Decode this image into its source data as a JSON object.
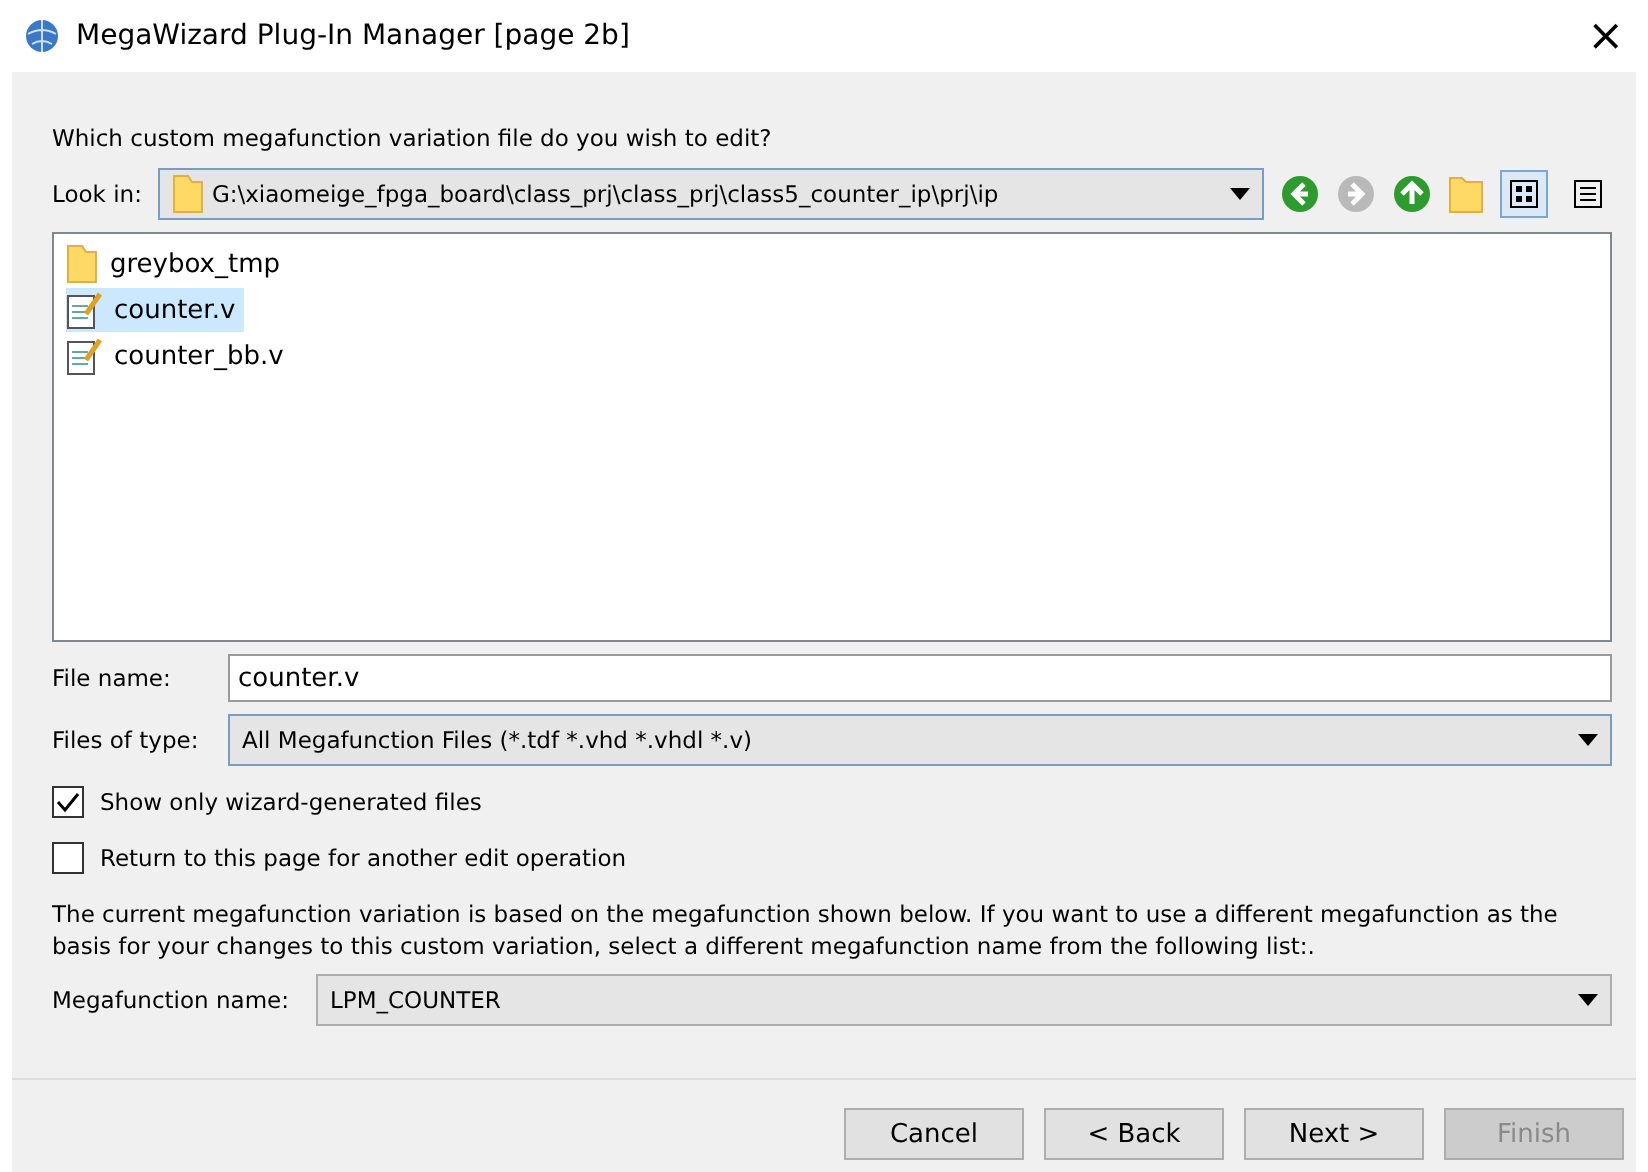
{
  "window": {
    "title": "MegaWizard Plug-In Manager [page 2b]",
    "close": "×"
  },
  "prompt": "Which custom megafunction variation file do you wish to edit?",
  "look_in": {
    "label": "Look in:",
    "value": "G:\\xiaomeige_fpga_board\\class_prj\\class_prj\\class5_counter_ip\\prj\\ip"
  },
  "toolbar": [
    {
      "kind": "back",
      "disabled": false
    },
    {
      "kind": "forward",
      "disabled": true
    },
    {
      "kind": "up",
      "disabled": false
    },
    {
      "kind": "newfolder"
    },
    {
      "kind": "list",
      "selected": true
    },
    {
      "kind": "details",
      "selected": false
    }
  ],
  "files": [
    {
      "name": "greybox_tmp",
      "kind": "folder",
      "selected": false
    },
    {
      "name": "counter.v",
      "kind": "file",
      "selected": true
    },
    {
      "name": "counter_bb.v",
      "kind": "file",
      "selected": false
    }
  ],
  "file_name": {
    "label": "File name:",
    "value": "counter.v"
  },
  "files_of_type": {
    "label": "Files of type:",
    "value": "All Megafunction Files (*.tdf *.vhd *.vhdl *.v)"
  },
  "checkboxes": [
    {
      "label": "Show only wizard-generated files",
      "checked": true
    },
    {
      "label": "Return to this page for another edit operation",
      "checked": false
    }
  ],
  "info": "The current megafunction variation is based on the megafunction shown below. If you want to use a different megafunction as the basis for your changes to this custom variation, select a different megafunction name from the following list:.",
  "megafunction": {
    "label": "Megafunction name:",
    "value": "LPM_COUNTER"
  },
  "buttons": [
    {
      "label": "Cancel",
      "disabled": false
    },
    {
      "label": "< Back",
      "disabled": false
    },
    {
      "label": "Next >",
      "disabled": false
    },
    {
      "label": "Finish",
      "disabled": true
    }
  ]
}
